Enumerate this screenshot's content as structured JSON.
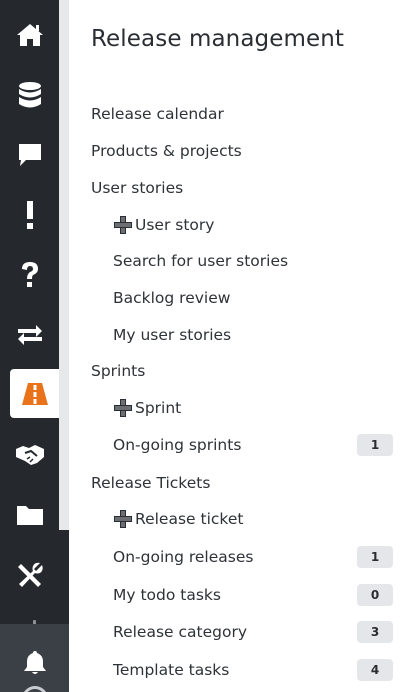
{
  "colors": {
    "rail_bg": "#25292e",
    "rail_icon": "#ffffff",
    "active_icon": "#e8731a",
    "badge_bg": "#e4e6e9",
    "text": "#2f3338"
  },
  "rail": {
    "items": [
      {
        "icon": "home-icon",
        "active": false
      },
      {
        "icon": "database-icon",
        "active": false
      },
      {
        "icon": "chat-icon",
        "active": false
      },
      {
        "icon": "exclamation-icon",
        "active": false
      },
      {
        "icon": "question-icon",
        "active": false
      },
      {
        "icon": "swap-arrows-icon",
        "active": false
      },
      {
        "icon": "road-icon",
        "active": true
      },
      {
        "icon": "handshake-icon",
        "active": false
      },
      {
        "icon": "folder-icon",
        "active": false
      },
      {
        "icon": "tools-icon",
        "active": false
      }
    ],
    "bottom": {
      "icon": "bell-icon"
    }
  },
  "page": {
    "title": "Release management"
  },
  "menu": {
    "release_calendar": "Release calendar",
    "products_projects": "Products & projects",
    "user_stories": "User stories",
    "add_user_story": "User story",
    "search_user_stories": "Search for user stories",
    "backlog_review": "Backlog review",
    "my_user_stories": "My user stories",
    "sprints": "Sprints",
    "add_sprint": "Sprint",
    "ongoing_sprints": "On-going sprints",
    "ongoing_sprints_count": "1",
    "release_tickets": "Release Tickets",
    "add_release_ticket": "Release ticket",
    "ongoing_releases": "On-going releases",
    "ongoing_releases_count": "1",
    "my_todo_tasks": "My todo tasks",
    "my_todo_tasks_count": "0",
    "release_category": "Release category",
    "release_category_count": "3",
    "template_tasks": "Template tasks",
    "template_tasks_count": "4"
  }
}
